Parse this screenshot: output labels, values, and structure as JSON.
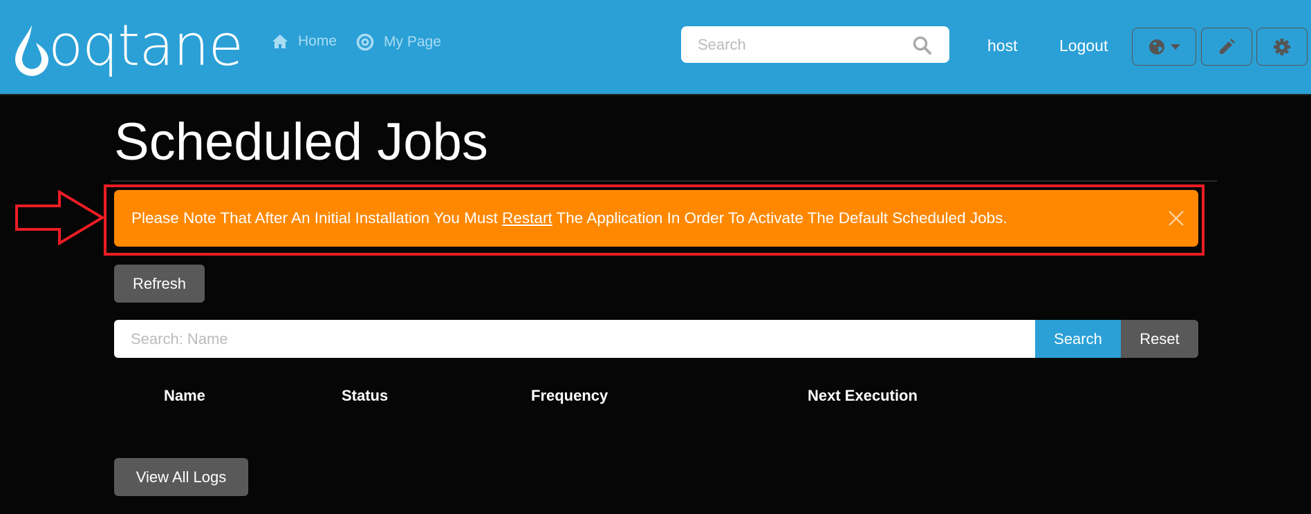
{
  "header": {
    "logo_text": "oqtane",
    "nav": [
      {
        "label": "Home",
        "icon": "home-icon"
      },
      {
        "label": "My Page",
        "icon": "target-icon"
      }
    ],
    "search_placeholder": "Search",
    "user": "host",
    "logout": "Logout",
    "buttons": [
      "globe-dropdown",
      "edit-pencil",
      "settings-gear"
    ]
  },
  "page": {
    "title": "Scheduled Jobs",
    "alert": {
      "before": "Please Note That After An Initial Installation You Must ",
      "link": "Restart",
      "after": " The Application In Order To Activate The Default Scheduled Jobs.",
      "color": "#ff8800"
    },
    "refresh": "Refresh",
    "filter": {
      "placeholder": "Search: Name",
      "search": "Search",
      "reset": "Reset"
    },
    "columns": [
      "Name",
      "Status",
      "Frequency",
      "Next Execution"
    ],
    "view_logs": "View All Logs"
  },
  "colors": {
    "header": "#2ba0d6",
    "annotation": "#ed1c24"
  }
}
